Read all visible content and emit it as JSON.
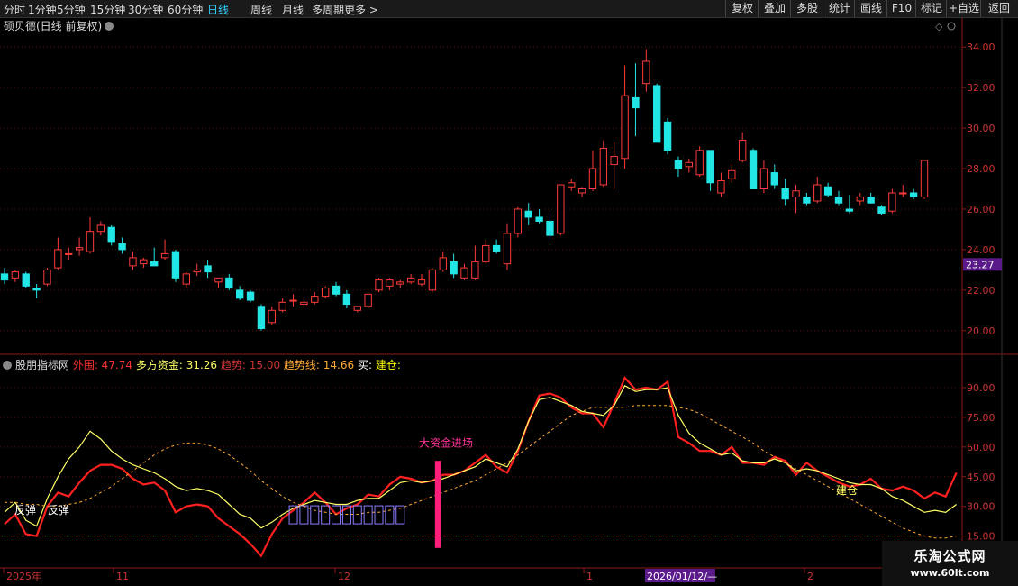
{
  "toolbar": {
    "left": [
      "分时",
      "1分钟",
      "5分钟",
      "15分钟",
      "30分钟",
      "60分钟",
      "日线",
      "周线",
      "月线",
      "多周期",
      "更多 >"
    ],
    "active": "日线",
    "right": [
      "复权",
      "叠加",
      "多股",
      "统计",
      "画线",
      "F10",
      "标记",
      "+自选",
      "返回"
    ]
  },
  "main_panel": {
    "title": "硕贝德(日线 前复权)",
    "price_tag": "23.27"
  },
  "indicator_panel": {
    "title": "股朋指标网",
    "readouts": [
      {
        "label": "外围:",
        "value": "47.74",
        "color": "#ff3030"
      },
      {
        "label": "多方资金:",
        "value": "31.26",
        "color": "#ffff66"
      },
      {
        "label": "趋势:",
        "value": "15.00",
        "color": "#cc3333"
      },
      {
        "label": "趋势线:",
        "value": "14.66",
        "color": "#ffaa33"
      },
      {
        "label": "买:",
        "value": "",
        "color": "#ffffff"
      },
      {
        "label": "建仓:",
        "value": "",
        "color": "#ffff00"
      }
    ],
    "annotations": [
      "反弹",
      "反弹",
      "大资金进场",
      "建仓"
    ]
  },
  "time_axis": {
    "labels": [
      "2025年",
      "11",
      "12",
      "1",
      "2026/01/12/—",
      "2"
    ]
  },
  "watermark": {
    "line1": "乐淘公式网",
    "line2": "www.60lt.com"
  },
  "chart_data": [
    {
      "type": "candlestick",
      "yaxis_ticks": [
        "34.00",
        "32.00",
        "30.00",
        "28.00",
        "26.00",
        "24.00",
        "22.00",
        "20.00"
      ],
      "ylim": [
        19.5,
        34.5
      ],
      "candles": [
        [
          22.8,
          23.1,
          22.3,
          22.5
        ],
        [
          22.6,
          23.0,
          22.4,
          22.9
        ],
        [
          22.8,
          22.9,
          22.1,
          22.2
        ],
        [
          22.1,
          22.3,
          21.6,
          22.0
        ],
        [
          22.3,
          23.1,
          22.2,
          23.0
        ],
        [
          23.1,
          24.6,
          23.0,
          24.0
        ],
        [
          23.8,
          24.1,
          23.5,
          23.8
        ],
        [
          24.0,
          24.6,
          23.7,
          24.1
        ],
        [
          23.9,
          25.6,
          23.8,
          24.9
        ],
        [
          24.9,
          25.4,
          24.7,
          25.2
        ],
        [
          25.1,
          25.2,
          24.2,
          24.4
        ],
        [
          24.3,
          24.6,
          23.8,
          24.0
        ],
        [
          23.2,
          23.9,
          23.0,
          23.6
        ],
        [
          23.3,
          23.6,
          23.1,
          23.5
        ],
        [
          23.4,
          24.1,
          23.3,
          23.2
        ],
        [
          23.6,
          24.5,
          23.5,
          23.8
        ],
        [
          23.9,
          24.0,
          22.4,
          22.6
        ],
        [
          22.3,
          22.9,
          22.1,
          22.8
        ],
        [
          22.9,
          23.3,
          22.7,
          23.0
        ],
        [
          23.2,
          23.5,
          22.6,
          22.9
        ],
        [
          22.4,
          22.6,
          22.1,
          22.6
        ],
        [
          22.6,
          22.8,
          22.0,
          22.1
        ],
        [
          22.0,
          22.2,
          21.5,
          21.6
        ],
        [
          21.9,
          22.0,
          21.4,
          21.5
        ],
        [
          21.2,
          21.3,
          20.0,
          20.1
        ],
        [
          20.4,
          21.2,
          20.3,
          21.0
        ],
        [
          21.0,
          21.6,
          20.9,
          21.4
        ],
        [
          21.5,
          21.8,
          21.2,
          21.5
        ],
        [
          21.3,
          21.7,
          21.2,
          21.4
        ],
        [
          21.4,
          21.9,
          21.3,
          21.7
        ],
        [
          21.7,
          22.2,
          21.6,
          22.1
        ],
        [
          22.2,
          22.4,
          21.7,
          21.8
        ],
        [
          21.8,
          22.0,
          21.1,
          21.3
        ],
        [
          21.0,
          21.2,
          20.9,
          21.2
        ],
        [
          21.2,
          21.9,
          21.1,
          21.8
        ],
        [
          22.0,
          22.6,
          21.9,
          22.5
        ],
        [
          22.2,
          22.6,
          22.0,
          22.5
        ],
        [
          22.3,
          22.5,
          22.1,
          22.4
        ],
        [
          22.4,
          22.8,
          22.3,
          22.6
        ],
        [
          22.3,
          22.8,
          22.2,
          22.5
        ],
        [
          22.0,
          23.1,
          21.9,
          23.0
        ],
        [
          23.0,
          23.9,
          22.9,
          23.6
        ],
        [
          23.4,
          23.8,
          22.6,
          22.8
        ],
        [
          22.6,
          23.3,
          22.5,
          23.1
        ],
        [
          22.6,
          24.2,
          22.5,
          23.4
        ],
        [
          23.4,
          24.5,
          23.3,
          24.2
        ],
        [
          24.2,
          24.5,
          23.8,
          23.9
        ],
        [
          23.3,
          25.3,
          23.0,
          24.8
        ],
        [
          24.8,
          26.1,
          24.6,
          26.0
        ],
        [
          25.9,
          26.3,
          25.2,
          25.6
        ],
        [
          25.6,
          26.0,
          25.3,
          25.4
        ],
        [
          25.4,
          25.8,
          24.5,
          24.7
        ],
        [
          24.8,
          27.2,
          24.7,
          27.2
        ],
        [
          27.1,
          27.5,
          26.9,
          27.3
        ],
        [
          26.8,
          27.1,
          26.6,
          27.0
        ],
        [
          27.0,
          28.9,
          26.9,
          28.0
        ],
        [
          27.2,
          29.4,
          27.1,
          29.0
        ],
        [
          28.2,
          29.3,
          27.0,
          28.6
        ],
        [
          28.5,
          33.1,
          28.0,
          31.6
        ],
        [
          31.5,
          33.2,
          29.6,
          31.0
        ],
        [
          32.2,
          33.9,
          31.8,
          33.3
        ],
        [
          32.1,
          32.2,
          29.7,
          29.3
        ],
        [
          30.3,
          30.5,
          28.7,
          28.9
        ],
        [
          28.4,
          28.6,
          27.6,
          28.0
        ],
        [
          28.1,
          28.5,
          27.8,
          28.3
        ],
        [
          27.7,
          29.1,
          27.6,
          28.9
        ],
        [
          28.9,
          28.9,
          26.9,
          27.3
        ],
        [
          26.8,
          27.8,
          26.6,
          27.4
        ],
        [
          27.5,
          28.2,
          27.3,
          27.9
        ],
        [
          28.4,
          29.8,
          28.3,
          29.4
        ],
        [
          28.9,
          29.0,
          27.5,
          27.0
        ],
        [
          27.0,
          28.4,
          26.8,
          28.0
        ],
        [
          27.8,
          28.2,
          27.0,
          27.2
        ],
        [
          27.0,
          27.5,
          26.2,
          26.5
        ],
        [
          26.6,
          27.2,
          25.8,
          26.9
        ],
        [
          26.6,
          26.8,
          26.2,
          26.3
        ],
        [
          26.4,
          27.6,
          26.3,
          27.2
        ],
        [
          27.1,
          27.3,
          26.6,
          26.7
        ],
        [
          26.6,
          26.9,
          26.2,
          26.3
        ],
        [
          26.0,
          26.7,
          25.8,
          25.9
        ],
        [
          26.4,
          26.8,
          26.2,
          26.6
        ],
        [
          26.6,
          26.8,
          26.3,
          26.3
        ],
        [
          26.1,
          26.2,
          25.7,
          25.8
        ],
        [
          25.9,
          27.0,
          25.8,
          26.8
        ],
        [
          26.8,
          27.2,
          26.6,
          26.8
        ],
        [
          26.8,
          27.0,
          26.5,
          26.6
        ],
        [
          26.6,
          28.4,
          26.5,
          28.4
        ]
      ]
    },
    {
      "type": "line",
      "yaxis_ticks": [
        "90.00",
        "75.00",
        "60.00",
        "45.00",
        "30.00",
        "15.00"
      ],
      "ylim": [
        8,
        100
      ],
      "series": [
        {
          "name": "外围",
          "values": [
            21,
            26,
            16,
            15,
            30,
            37,
            35,
            42,
            48,
            51,
            51,
            49,
            44,
            41,
            42,
            38,
            27,
            30,
            31,
            30,
            24,
            20,
            16,
            11,
            5,
            16,
            24,
            28,
            32,
            37,
            32,
            26,
            29,
            31,
            36,
            35,
            41,
            45,
            44,
            42,
            43,
            46,
            46,
            48,
            52,
            56,
            50,
            47,
            58,
            73,
            86,
            87,
            85,
            80,
            77,
            77,
            70,
            82,
            95,
            89,
            90,
            89,
            93,
            65,
            62,
            58,
            58,
            56,
            60,
            52,
            52,
            51,
            55,
            53,
            46,
            52,
            48,
            45,
            42,
            40,
            41,
            44,
            39,
            38,
            40,
            38,
            34,
            37,
            35,
            47
          ]
        },
        {
          "name": "多方资金",
          "values": [
            27,
            32,
            23,
            20,
            34,
            45,
            54,
            60,
            68,
            64,
            58,
            54,
            51,
            49,
            47,
            44,
            40,
            38,
            39,
            38,
            36,
            31,
            26,
            24,
            19,
            22,
            26,
            29,
            31,
            33,
            32,
            31,
            31,
            33,
            34,
            34,
            38,
            42,
            43,
            42,
            43,
            44,
            46,
            48,
            50,
            54,
            52,
            50,
            59,
            73,
            84,
            85,
            83,
            81,
            78,
            77,
            76,
            81,
            91,
            88,
            89,
            89,
            90,
            76,
            67,
            62,
            59,
            56,
            57,
            53,
            52,
            52,
            54,
            52,
            48,
            49,
            48,
            46,
            44,
            42,
            41,
            41,
            39,
            35,
            33,
            30,
            27,
            28,
            27,
            31
          ]
        },
        {
          "name": "趋势线",
          "values": [
            32,
            32,
            31,
            31,
            30,
            30,
            31,
            32,
            34,
            37,
            40,
            44,
            48,
            52,
            56,
            59,
            61,
            62,
            62,
            61,
            59,
            56,
            52,
            48,
            43,
            39,
            35,
            32,
            30,
            28,
            27,
            26,
            26,
            26,
            27,
            27,
            28,
            29,
            31,
            33,
            35,
            37,
            39,
            41,
            43,
            46,
            49,
            52,
            56,
            60,
            64,
            68,
            72,
            76,
            78,
            80,
            80,
            80,
            80,
            81,
            81,
            81,
            81,
            80,
            79,
            77,
            74,
            71,
            68,
            65,
            62,
            58,
            55,
            52,
            49,
            46,
            43,
            40,
            37,
            34,
            31,
            28,
            25,
            22,
            19,
            17,
            15,
            14,
            14,
            15
          ]
        }
      ]
    }
  ]
}
